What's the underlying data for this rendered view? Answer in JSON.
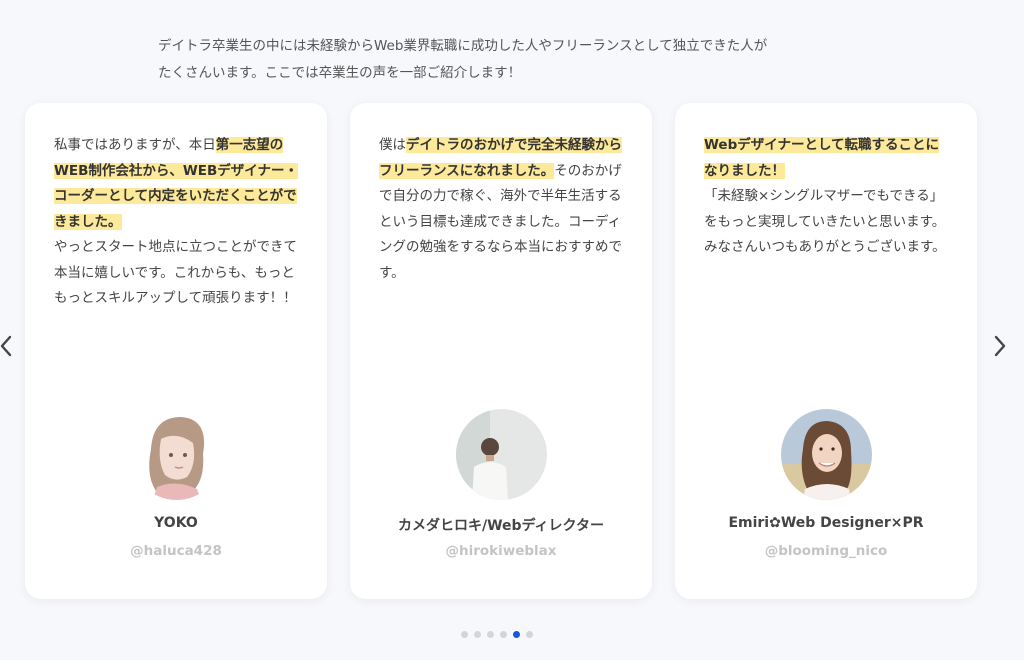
{
  "intro": {
    "line1": "デイトラ卒業生の中には未経験からWeb業界転職に成功した人やフリーランスとして独立できた人が",
    "line2": "たくさんいます。ここでは卒業生の声を一部ご紹介します！"
  },
  "testimonials": [
    {
      "text_before": "私事ではありますが、本日",
      "highlight": "第一志望のWEB制作会社から、WEBデザイナー・コーダーとして内定をいただくことができました。",
      "text_after": "やっとスタート地点に立つことができて本当に嬉しいです。これからも、もっともっとスキルアップして頑張ります！！",
      "name": "YOKO",
      "handle": "@haluca428"
    },
    {
      "text_before": "僕は",
      "highlight": "デイトラのおかげで完全未経験からフリーランスになれました。",
      "text_after": "そのおかげで自分の力で稼ぐ、海外で半年生活するという目標も達成できました。コーディングの勉強をするなら本当におすすめです。",
      "name": "カメダヒロキ/Webディレクター",
      "handle": "@hirokiweblax"
    },
    {
      "text_before": "",
      "highlight": "Webデザイナーとして転職することになりました！",
      "text_after": "「未経験×シングルマザーでもできる」をもっと実現していきたいと思います。みなさんいつもありがとうございます。",
      "name": "Emiri✿Web Designer×PR",
      "handle": "@blooming_nico"
    }
  ],
  "carousel": {
    "prev_icon": "chevron-left-icon",
    "next_icon": "chevron-right-icon",
    "dot_count": 6,
    "active_dot": 5
  },
  "colors": {
    "highlight": "#fde99a",
    "active_dot": "#1c55d6",
    "inactive_dot": "#d5d5d5"
  }
}
